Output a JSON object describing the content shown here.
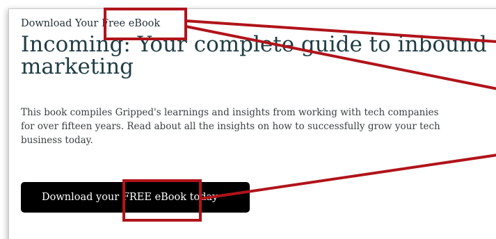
{
  "card": {
    "eyebrow_prefix": "Download Your ",
    "eyebrow_highlight": "Free eBook",
    "headline": "Incoming: Your complete guide to inbound marketing",
    "body": "This book compiles Gripped's learnings and insights from working with tech companies for over fifteen years. Read about all the insights on how to successfully grow your tech business today.",
    "cta_prefix": "Download your ",
    "cta_highlight": "FREE eBook",
    "cta_suffix": " today"
  },
  "colors": {
    "annotation": "#b0141a",
    "headline": "#1f3d44",
    "cta_background": "#000000"
  }
}
